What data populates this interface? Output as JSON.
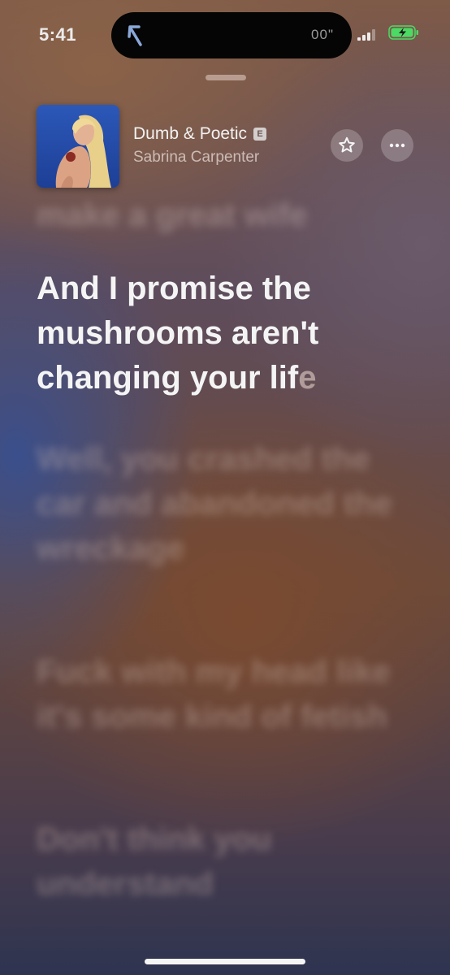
{
  "status_bar": {
    "time": "5:41",
    "island_text": "00\"",
    "battery_color": "#4cd964"
  },
  "now_playing": {
    "title": "Dumb & Poetic",
    "explicit_badge": "E",
    "artist": "Sabrina Carpenter",
    "favorite_icon": "star-icon",
    "more_icon": "ellipsis-icon"
  },
  "lyrics": {
    "previous": "make a great wife",
    "current_sung": "And I promise the mushrooms aren't changing your lif",
    "current_unsung": "e",
    "upcoming": [
      "Well, you crashed the car and abandoned the wreckage",
      "Fuck with my head like it's some kind of fetish",
      "Don't think you understand"
    ]
  }
}
